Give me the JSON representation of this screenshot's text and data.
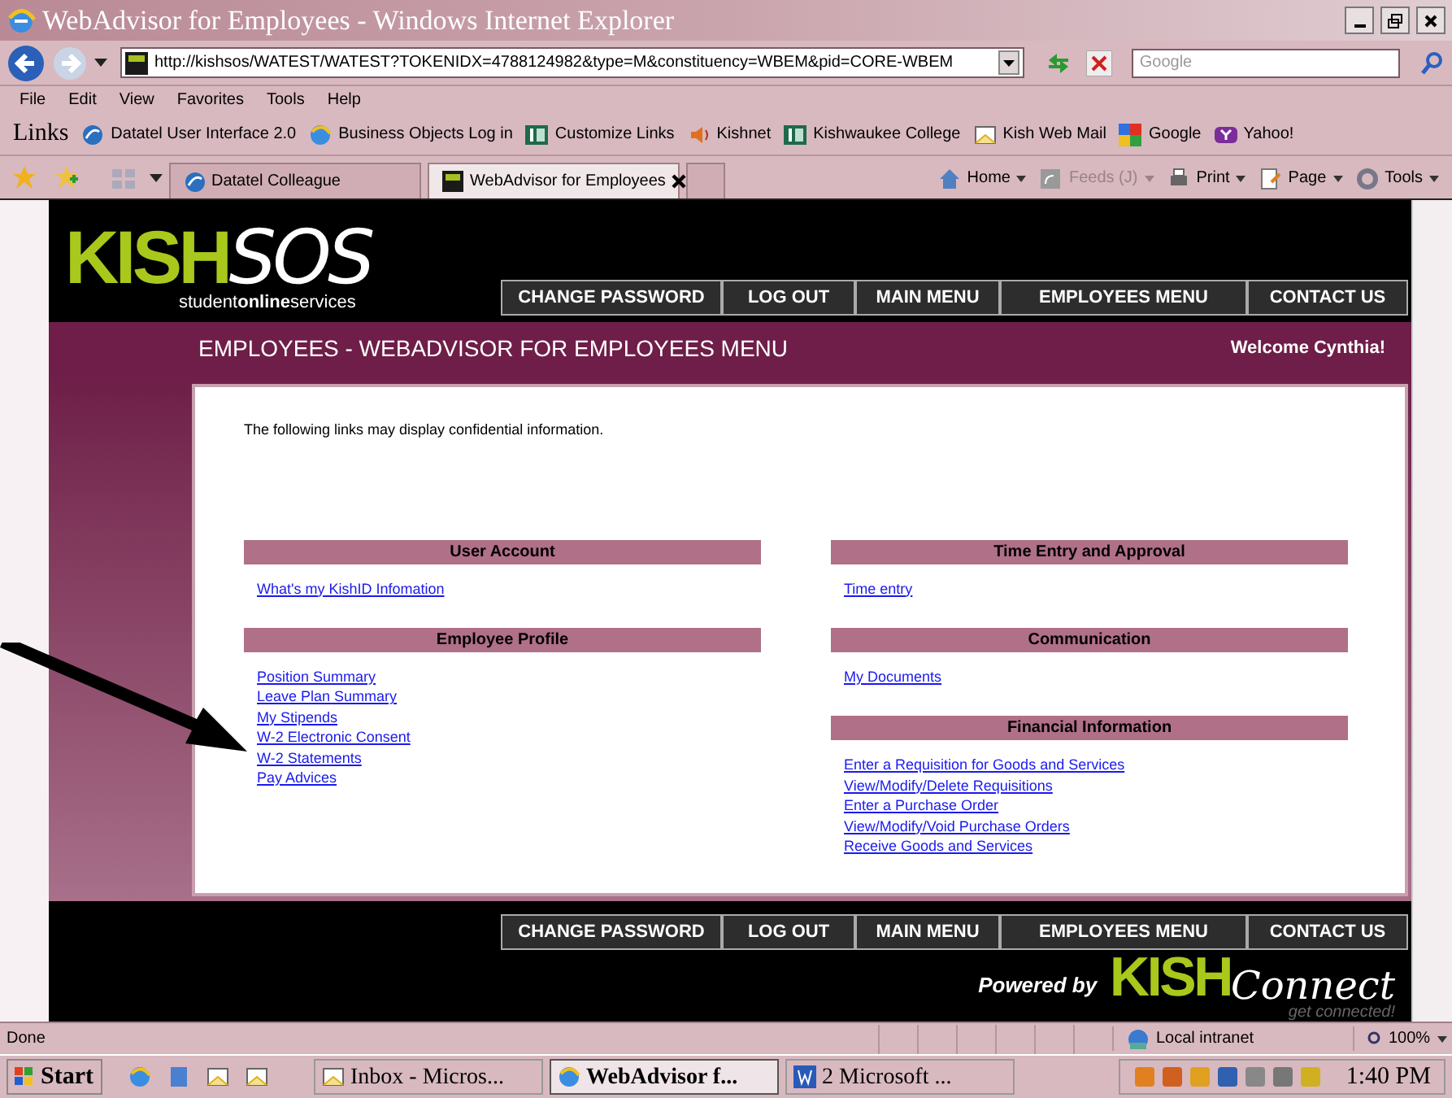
{
  "window": {
    "title": "WebAdvisor for Employees - Windows Internet Explorer"
  },
  "address_bar": {
    "url": "http://kishsos/WATEST/WATEST?TOKENIDX=4788124982&type=M&constituency=WBEM&pid=CORE-WBEM"
  },
  "search": {
    "placeholder": "Google"
  },
  "menu": [
    "File",
    "Edit",
    "View",
    "Favorites",
    "Tools",
    "Help"
  ],
  "links_bar": {
    "label": "Links",
    "items": [
      {
        "label": "Datatel User Interface 2.0",
        "kind": "globe"
      },
      {
        "label": "Business Objects Log in",
        "kind": "ie"
      },
      {
        "label": "Customize Links",
        "kind": "kc"
      },
      {
        "label": "Kishnet",
        "kind": "speaker"
      },
      {
        "label": "Kishwaukee College",
        "kind": "kc"
      },
      {
        "label": "Kish Web Mail",
        "kind": "mail"
      },
      {
        "label": "Google",
        "kind": "google"
      },
      {
        "label": "Yahoo!",
        "kind": "yahoo"
      }
    ]
  },
  "tabs": [
    {
      "label": "Datatel Colleague",
      "selected": false
    },
    {
      "label": "WebAdvisor for Employees",
      "selected": true
    }
  ],
  "command_bar": [
    {
      "label": "Home",
      "disabled": false
    },
    {
      "label": "Feeds (J)",
      "disabled": true
    },
    {
      "label": "Print",
      "disabled": false
    },
    {
      "label": "Page",
      "disabled": false
    },
    {
      "label": "Tools",
      "disabled": false
    }
  ],
  "site": {
    "logo": {
      "brand": "KISH",
      "suffix": "SOS",
      "tagline_start": "student",
      "tagline_bold": "online",
      "tagline_end": "services"
    },
    "nav": [
      "CHANGE PASSWORD",
      "LOG OUT",
      "MAIN MENU",
      "EMPLOYEES MENU",
      "CONTACT US"
    ],
    "page_title": "EMPLOYEES - WEBADVISOR FOR EMPLOYEES MENU",
    "welcome": "Welcome Cynthia!",
    "notice": "The following links may display confidential information.",
    "columns": [
      [
        {
          "title": "User Account",
          "links": [
            "What's my KishID Infomation"
          ]
        },
        {
          "title": "Employee Profile",
          "links": [
            "Position Summary",
            "Leave Plan Summary",
            "My Stipends",
            "W-2 Electronic Consent",
            "W-2 Statements",
            "Pay Advices"
          ]
        }
      ],
      [
        {
          "title": "Time Entry and Approval",
          "links": [
            "Time entry"
          ]
        },
        {
          "title": "Communication",
          "links": [
            "My Documents"
          ]
        },
        {
          "title": "Financial Information",
          "links": [
            "Enter a Requisition for Goods and Services",
            "View/Modify/Delete Requisitions",
            "Enter a Purchase Order",
            "View/Modify/Void Purchase Orders",
            "Receive Goods and Services"
          ]
        }
      ]
    ],
    "footer_nav": [
      "CHANGE PASSWORD",
      "LOG OUT",
      "MAIN MENU",
      "EMPLOYEES MENU",
      "CONTACT US"
    ],
    "powered_by": "Powered by",
    "footer_logo": {
      "brand": "KISH",
      "script": "Connect",
      "tagline": "get connected!"
    }
  },
  "status_bar": {
    "text": "Done",
    "zone": "Local intranet",
    "zoom": "100%"
  },
  "taskbar": {
    "start": "Start",
    "tasks": [
      {
        "label": "Inbox - Micros...",
        "selected": false
      },
      {
        "label": "WebAdvisor f...",
        "selected": true
      },
      {
        "label": "2 Microsoft ...",
        "selected": false
      }
    ],
    "clock": "1:40 PM"
  }
}
